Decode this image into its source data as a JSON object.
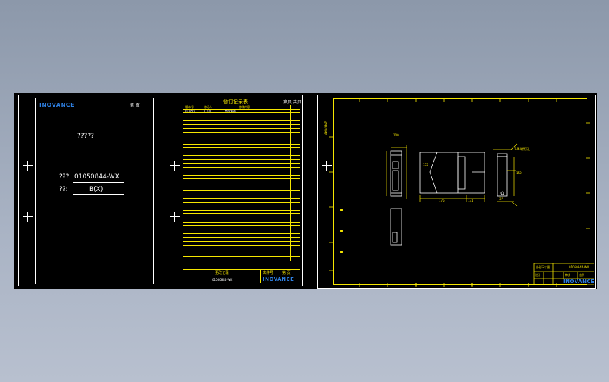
{
  "cover": {
    "logo": "INOVANCE",
    "corner": "第 页",
    "title": "?????",
    "code_label": "???",
    "code_value": "01050844-WX",
    "version_label": "??:",
    "version_value": "B(X)"
  },
  "revision": {
    "title": "修订记录表",
    "corner": "第页 共页",
    "columns": [
      "版本号",
      "修订人",
      "修改内容"
    ],
    "first_row": [
      "01050",
      "1.0.0",
      "首次发布"
    ],
    "footer_center": "更改记录",
    "footer_right_a": "文件号",
    "footer_right_b": "第 页",
    "footer_code": "01050844-WX",
    "footer_logo": "INOVANCE"
  },
  "drawing": {
    "side_text": "仅供参考",
    "dims": [
      "175",
      "131",
      "100",
      "155",
      "150",
      "37"
    ],
    "note": "2-M4螺钉孔",
    "title_block": {
      "top_left": "外形尺寸图",
      "top_right": "01050844-WX",
      "cells": [
        "设计",
        "审核",
        "比例"
      ],
      "logo": "INOVANCE"
    }
  },
  "colors": {
    "background": "#000000",
    "frame_white": "#ffffff",
    "frame_yellow": "#f5e600",
    "brand": "#2e7fe0"
  }
}
